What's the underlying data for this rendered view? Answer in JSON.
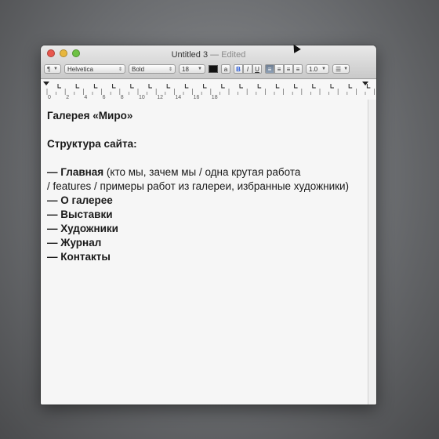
{
  "window": {
    "title": "Untitled 3",
    "separator": "—",
    "status": "Edited"
  },
  "toolbar": {
    "paragraph_style": "¶",
    "font_family": "Helvetica",
    "font_style": "Bold",
    "font_size": "18",
    "text_color": "#111111",
    "highlight_label": "a",
    "bold_label": "B",
    "italic_label": "I",
    "underline_label": "U",
    "spacing_label": "1.0"
  },
  "ruler": {
    "labels": [
      "0",
      "2",
      "4",
      "6",
      "8",
      "10",
      "12",
      "14",
      "16",
      "18"
    ]
  },
  "document": {
    "heading": "Галерея «Миро»",
    "structure_label": "Структура сайта:",
    "items": [
      {
        "dash": "—",
        "title": "Главная",
        "detail": " (кто мы, зачем мы / одна крутая работа"
      },
      {
        "dash": "",
        "title": "",
        "detail": " / features / примеры работ из галереи, избранные художники)"
      },
      {
        "dash": "—",
        "title": "О галерее",
        "detail": ""
      },
      {
        "dash": "—",
        "title": "Выставки",
        "detail": ""
      },
      {
        "dash": "—",
        "title": "Художники",
        "detail": ""
      },
      {
        "dash": "—",
        "title": "Журнал",
        "detail": ""
      },
      {
        "dash": "—",
        "title": "Контакты",
        "detail": ""
      }
    ]
  }
}
